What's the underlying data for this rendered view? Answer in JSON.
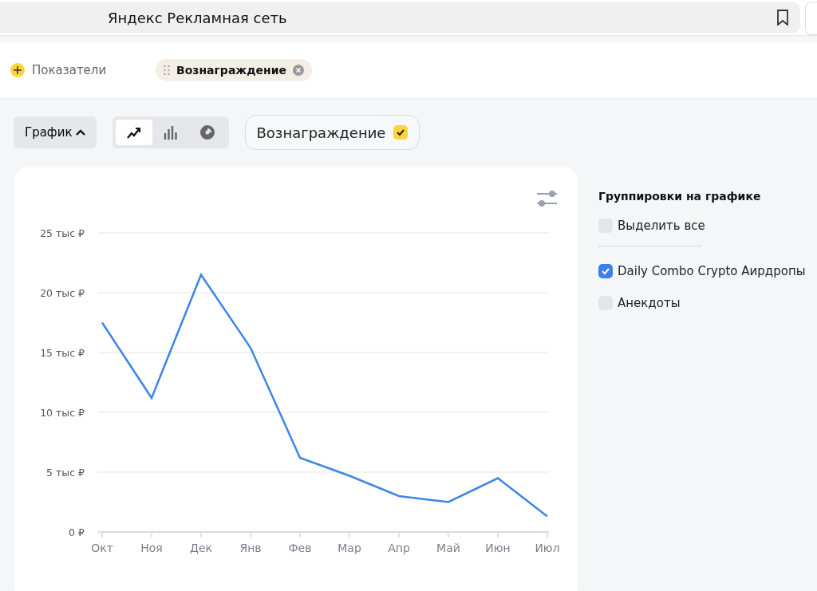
{
  "header": {
    "title": "Яндекс Рекламная сеть"
  },
  "metrics_bar": {
    "add_label": "Показатели",
    "chips": [
      {
        "label": "Вознаграждение"
      }
    ]
  },
  "toolbar": {
    "view_label": "График",
    "chart_types": [
      {
        "kind": "line",
        "selected": true
      },
      {
        "kind": "bar",
        "selected": false
      },
      {
        "kind": "pie",
        "selected": false
      }
    ],
    "metric_toggle": {
      "label": "Вознаграждение",
      "checked": true
    }
  },
  "chart": {
    "chart_data": {
      "type": "line",
      "categories": [
        "Окт",
        "Ноя",
        "Дек",
        "Янв",
        "Фев",
        "Мар",
        "Апр",
        "Май",
        "Июн",
        "Июл"
      ],
      "grid": true,
      "series": [
        {
          "color": "#3b86e8",
          "values": [
            17.5,
            11.2,
            21.5,
            15.4,
            6.2,
            4.7,
            3.0,
            2.5,
            4.5,
            1.3
          ]
        }
      ],
      "ylim": [
        0,
        25
      ],
      "yticks": [
        {
          "value": 0,
          "label": "0 ₽"
        },
        {
          "value": 5,
          "label": "5 тыс ₽"
        },
        {
          "value": 10,
          "label": "10 тыс ₽"
        },
        {
          "value": 15,
          "label": "15 тыс ₽"
        },
        {
          "value": 20,
          "label": "20 тыс ₽"
        },
        {
          "value": 25,
          "label": "25 тыс ₽"
        }
      ]
    }
  },
  "groupings": {
    "title": "Группировки на графике",
    "select_all": {
      "label": "Выделить все",
      "checked": false
    },
    "items": [
      {
        "label": "Daily Combo Crypto Аирдропы",
        "checked": true
      },
      {
        "label": "Анекдоты",
        "checked": false
      }
    ]
  }
}
